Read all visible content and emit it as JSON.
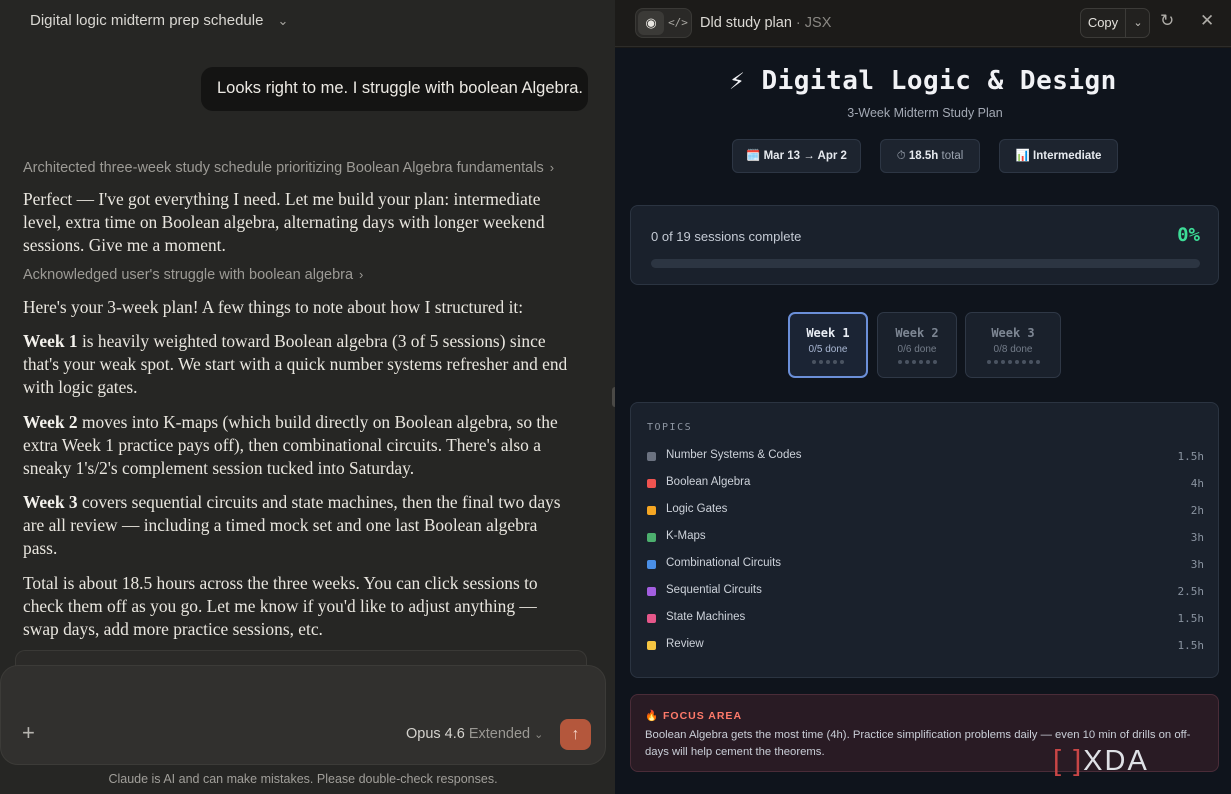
{
  "conversation": {
    "title": "Digital logic midterm prep schedule",
    "user_message": "Looks right to me. I struggle with boolean Algebra.",
    "thought_1": "Architected three-week study schedule prioritizing Boolean Algebra fundamentals",
    "reply_1": "Perfect — I've got everything I need. Let me build your plan: intermediate level, extra time on Boolean algebra, alternating days with longer weekend sessions. Give me a moment.",
    "thought_2": "Acknowledged user's struggle with boolean algebra",
    "reply_2": "Here's your 3-week plan! A few things to note about how I structured it:",
    "week1_label": "Week 1",
    "week1_text": " is heavily weighted toward Boolean algebra (3 of 5 sessions) since that's your weak spot. We start with a quick number systems refresher and end with logic gates.",
    "week2_label": "Week 2",
    "week2_text": " moves into K-maps (which build directly on Boolean algebra, so the extra Week 1 practice pays off), then combinational circuits. There's also a sneaky 1's/2's complement session tucked into Saturday.",
    "week3_label": "Week 3",
    "week3_text": " covers sequential circuits and state machines, then the final two days are all review — including a timed mock set and one last Boolean algebra pass.",
    "reply_closing": "Total is about 18.5 hours across the three weeks. You can click sessions to check them off as you go. Let me know if you'd like to adjust anything — swap days, add more practice sessions, etc."
  },
  "composer": {
    "model": "Opus 4.6",
    "mode": "Extended",
    "disclaimer": "Claude is AI and can make mistakes. Please double-check responses."
  },
  "artifact": {
    "title": "Dld study plan",
    "type": "JSX",
    "copy_label": "Copy"
  },
  "study_plan": {
    "title": "⚡ Digital Logic & Design",
    "subtitle": "3-Week Midterm Study Plan",
    "dates": "🗓️ Mar 13 → Apr 2",
    "total_icon": "⏱",
    "total_value": "18.5h",
    "total_label": "total",
    "level": "📊 Intermediate",
    "progress_text": "0 of 19 sessions complete",
    "progress_pct_label": "0%",
    "progress_fraction": 0,
    "weeks": [
      {
        "label": "Week 1",
        "done": "0/5 done",
        "sessions": 5
      },
      {
        "label": "Week 2",
        "done": "0/6 done",
        "sessions": 6
      },
      {
        "label": "Week 3",
        "done": "0/8 done",
        "sessions": 8
      }
    ],
    "topics_heading": "TOPICS",
    "topics": [
      {
        "name": "Number Systems & Codes",
        "hours": "1.5h",
        "color": "#6b7280"
      },
      {
        "name": "Boolean Algebra",
        "hours": "4h",
        "color": "#ef5350"
      },
      {
        "name": "Logic Gates",
        "hours": "2h",
        "color": "#f5a623"
      },
      {
        "name": "K-Maps",
        "hours": "3h",
        "color": "#4caf6e"
      },
      {
        "name": "Combinational Circuits",
        "hours": "3h",
        "color": "#4a8fe7"
      },
      {
        "name": "Sequential Circuits",
        "hours": "2.5h",
        "color": "#a35ee0"
      },
      {
        "name": "State Machines",
        "hours": "1.5h",
        "color": "#e5578a"
      },
      {
        "name": "Review",
        "hours": "1.5h",
        "color": "#f5c542"
      }
    ],
    "focus_label": "🔥 FOCUS AREA",
    "focus_text": "Boolean Algebra gets the most time (4h). Practice simplification problems daily — even 10 min of drills on off-days will help cement the theorems."
  },
  "watermark": "XDA"
}
